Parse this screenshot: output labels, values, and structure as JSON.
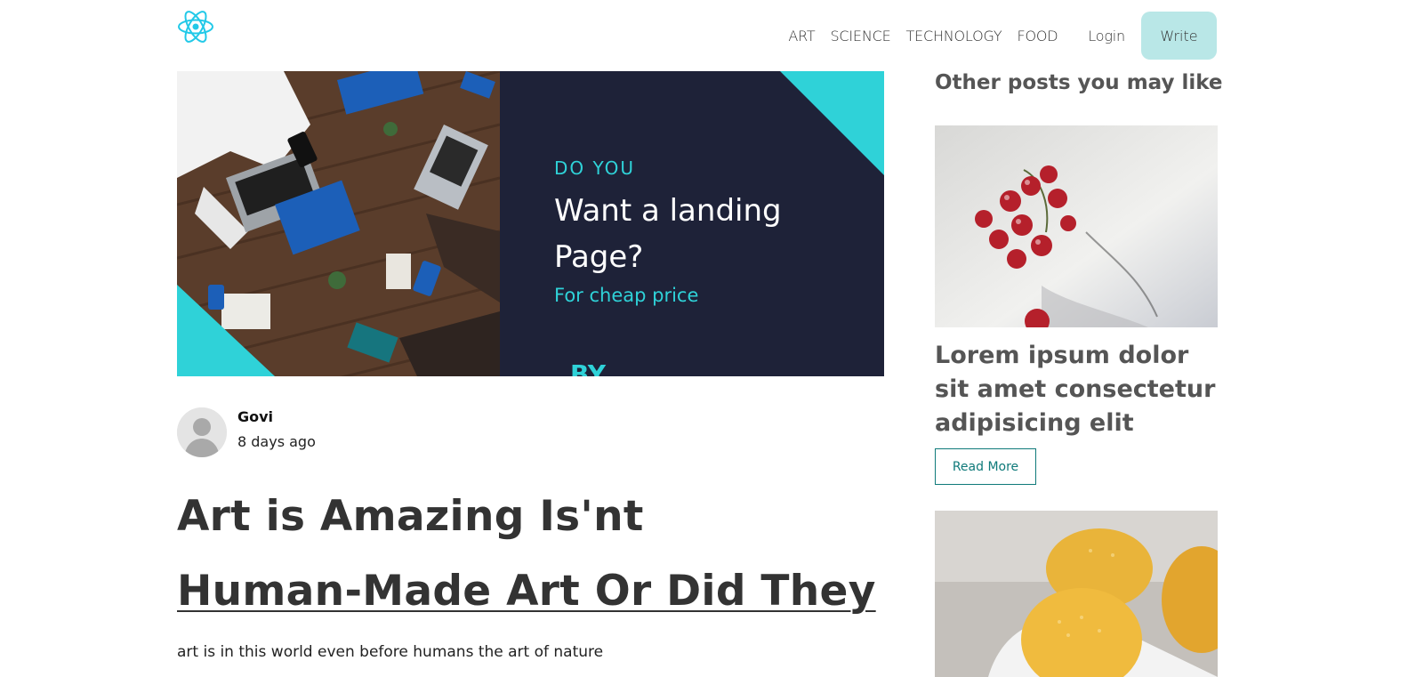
{
  "nav": {
    "logo_icon": "react-atom-icon",
    "links": [
      "ART",
      "SCIENCE",
      "TECHNOLOGY",
      "FOOD"
    ],
    "login_label": "Login",
    "write_label": "Write"
  },
  "hero": {
    "kicker": "DO YOU",
    "headline_line1": "Want a landing",
    "headline_line2": "Page?",
    "subline": "For cheap price",
    "footer_fragment": "BY"
  },
  "author": {
    "name": "Govi",
    "date": "8 days ago"
  },
  "post": {
    "title": "Art is Amazing Is'nt",
    "heading": "Human-Made Art Or Did They",
    "body": "art is in this world even before humans the art of nature"
  },
  "sidebar": {
    "title": "Other posts you may like",
    "posts": [
      {
        "title": "Lorem ipsum dolor sit amet consectetur adipisicing elit",
        "read_more_label": "Read More"
      }
    ]
  },
  "colors": {
    "accent": "#2fd2d8",
    "write_button": "#b9e7e7",
    "read_more": "#0f7a7a",
    "hero_dark": "#1e2238"
  }
}
